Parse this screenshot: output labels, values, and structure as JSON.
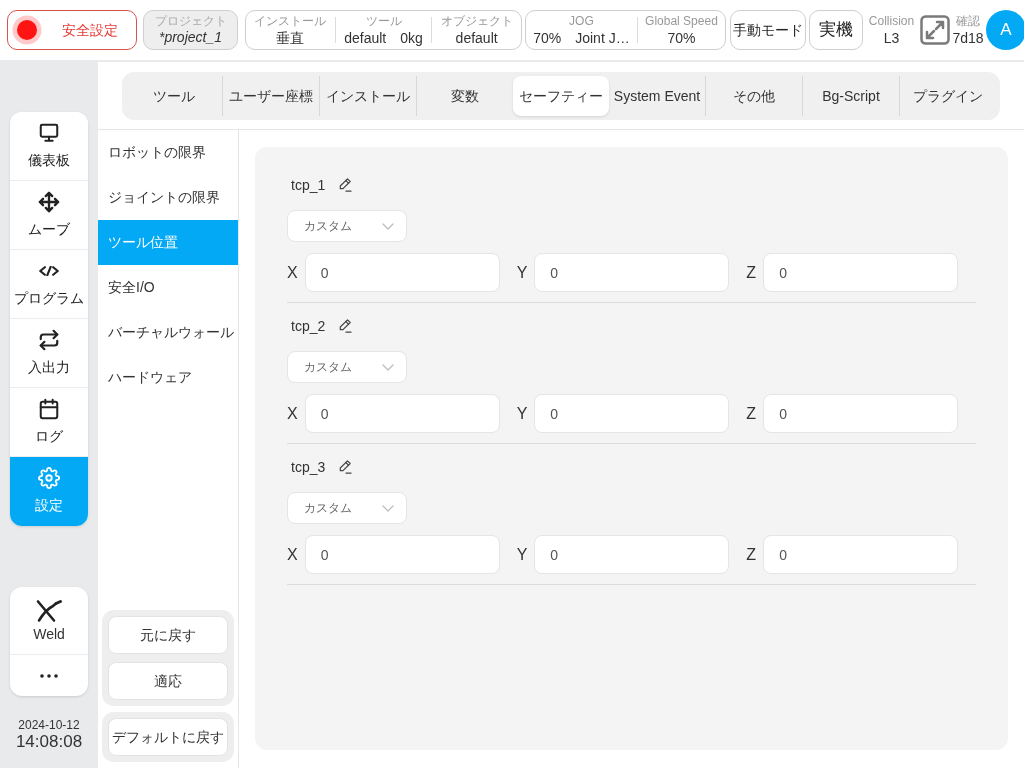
{
  "top_bar": {
    "safety_button": {
      "label": "安全設定"
    },
    "project": {
      "label": "プロジェクト",
      "value": "*project_1"
    },
    "status_groups": [
      {
        "items": [
          {
            "label": "インストール",
            "values": [
              "垂直"
            ]
          },
          {
            "label": "ツール",
            "values": [
              "default",
              "0kg"
            ]
          },
          {
            "label": "オブジェクト",
            "values": [
              "default"
            ]
          }
        ]
      },
      {
        "items": [
          {
            "label": "JOG",
            "values": [
              "70%",
              "Joint J…"
            ]
          },
          {
            "label": "Global Speed",
            "values": [
              "70%"
            ]
          }
        ]
      }
    ],
    "mode_buttons": [
      {
        "label": "手動モード"
      },
      {
        "label": "実機"
      }
    ],
    "collision": {
      "label": "Collision",
      "value": "L3"
    },
    "confirm": {
      "label": "確認",
      "value": "7d18"
    },
    "avatar": {
      "initial": "A"
    }
  },
  "nav": {
    "items": [
      {
        "label": "儀表板",
        "selected": false
      },
      {
        "label": "ムーブ",
        "selected": false
      },
      {
        "label": "プログラム",
        "selected": false
      },
      {
        "label": "入出力",
        "selected": false
      },
      {
        "label": "ログ",
        "selected": false
      },
      {
        "label": "設定",
        "selected": true
      }
    ]
  },
  "apps": {
    "items": [
      {
        "label": "Weld"
      }
    ]
  },
  "clock": {
    "date": "2024-10-12",
    "time": "14:08:08"
  },
  "tabs": [
    {
      "label": "ツール",
      "selected": false
    },
    {
      "label": "ユーザー座標",
      "selected": false
    },
    {
      "label": "インストール",
      "selected": false
    },
    {
      "label": "変数",
      "selected": false
    },
    {
      "label": "セーフティー",
      "selected": true
    },
    {
      "label": "System Event",
      "selected": false
    },
    {
      "label": "その他",
      "selected": false
    },
    {
      "label": "Bg-Script",
      "selected": false
    },
    {
      "label": "プラグイン",
      "selected": false
    }
  ],
  "subnav": {
    "items": [
      {
        "label": "ロボットの限界",
        "selected": false
      },
      {
        "label": "ジョイントの限界",
        "selected": false
      },
      {
        "label": "ツール位置",
        "selected": true
      },
      {
        "label": "安全I/O",
        "selected": false
      },
      {
        "label": "バーチャルウォール",
        "selected": false
      },
      {
        "label": "ハードウェア",
        "selected": false
      }
    ],
    "button_groups": [
      {
        "buttons": [
          "元に戻す",
          "適応"
        ]
      },
      {
        "buttons": [
          "デフォルトに戻す"
        ]
      }
    ]
  },
  "tcps": [
    {
      "name": "tcp_1",
      "mode": "カスタム",
      "coords": [
        {
          "label": "X",
          "value": "0"
        },
        {
          "label": "Y",
          "value": "0"
        },
        {
          "label": "Z",
          "value": "0"
        }
      ]
    },
    {
      "name": "tcp_2",
      "mode": "カスタム",
      "coords": [
        {
          "label": "X",
          "value": "0"
        },
        {
          "label": "Y",
          "value": "0"
        },
        {
          "label": "Z",
          "value": "0"
        }
      ]
    },
    {
      "name": "tcp_3",
      "mode": "カスタム",
      "coords": [
        {
          "label": "X",
          "value": "0"
        },
        {
          "label": "Y",
          "value": "0"
        },
        {
          "label": "Z",
          "value": "0"
        }
      ]
    }
  ]
}
